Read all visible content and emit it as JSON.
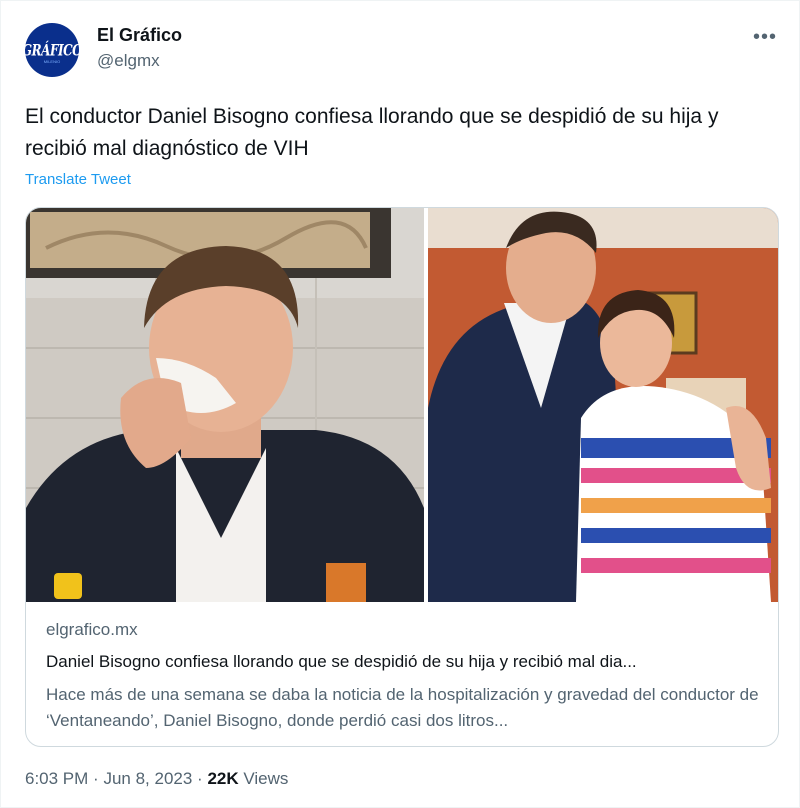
{
  "author": {
    "name": "El Gráfico",
    "handle": "@elgmx",
    "avatar_text": "GRÁFICO",
    "avatar_subtext": "MILENIO",
    "avatar_color": "#0a2f8c"
  },
  "menu": {
    "more_icon": "more-horizontal-icon",
    "more_label": "•••"
  },
  "tweet": {
    "text": "El conductor Daniel Bisogno confiesa llorando que se despidió de su hija y recibió mal diagnóstico de VIH",
    "translate_label": "Translate Tweet"
  },
  "card": {
    "domain": "elgrafico.mx",
    "title": "Daniel Bisogno confiesa llorando que se despidió de su hija y recibió mal dia...",
    "description": "Hace más de una semana se daba la noticia de la hospitalización y gravedad del conductor de ‘Ventaneando’, Daniel Bisogno, donde perdió casi dos litros..."
  },
  "meta": {
    "time": "6:03 PM",
    "separator": "·",
    "date": "Jun 8, 2023",
    "views_count": "22K",
    "views_label": "Views"
  },
  "colors": {
    "link": "#1d9bf0",
    "secondary_text": "#536471",
    "primary_text": "#0f1419",
    "border": "#cfd9de"
  }
}
